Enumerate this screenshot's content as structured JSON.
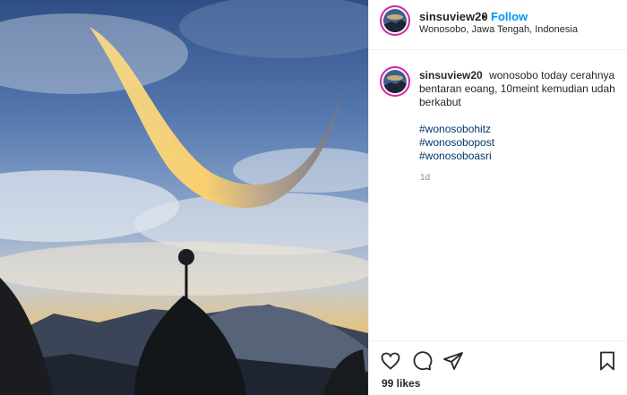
{
  "post": {
    "username": "sinsuview20",
    "follow_label": "Follow",
    "dot": "•",
    "location": "Wonosobo, Jawa Tengah, Indonesia",
    "caption_text": "wonosobo today cerahnya bentaran eoang, 10meint kemudian udah berkabut",
    "hashtags": [
      "#wonosobohitz",
      "#wonosobopost",
      "#wonosoboasri"
    ],
    "time": "1d",
    "likes": "99 likes"
  },
  "icons": {
    "like": "heart-icon",
    "comment": "comment-icon",
    "share": "share-icon",
    "save": "bookmark-icon"
  },
  "colors": {
    "follow": "#0095f6",
    "hashtag": "#00376b",
    "avatar_ring": "#d6249f",
    "time": "#8e8e8e"
  }
}
